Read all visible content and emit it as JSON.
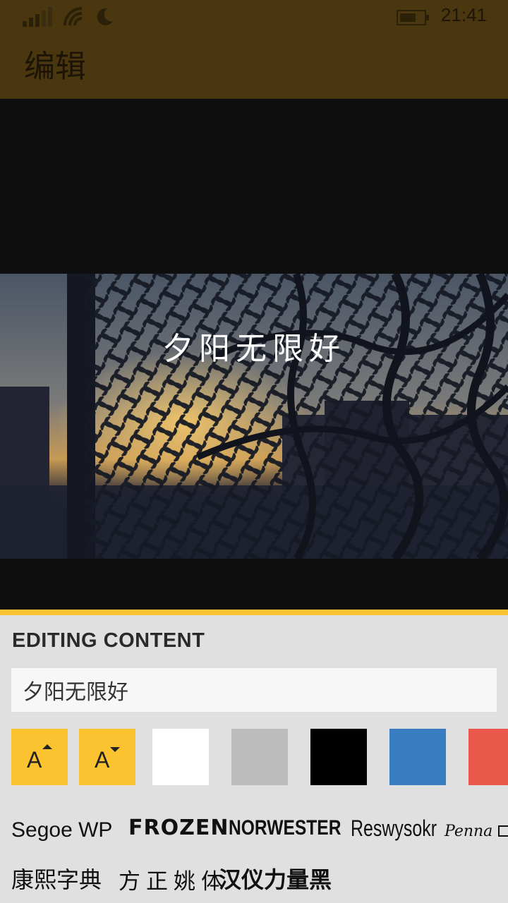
{
  "status_bar": {
    "time": "21:41"
  },
  "header": {
    "title": "编辑"
  },
  "canvas": {
    "overlay_text": "夕阳无限好"
  },
  "panel": {
    "title": "EDITING CONTENT",
    "input_value": "夕阳无限好",
    "tools": [
      {
        "name": "increase-font-size",
        "label": "A",
        "icon": "caret-up"
      },
      {
        "name": "decrease-font-size",
        "label": "A",
        "icon": "caret-down"
      }
    ],
    "colors": [
      "#ffffff",
      "#bcbcbc",
      "#000000",
      "#3a7ec2",
      "#e9584a"
    ],
    "accent": "#fcc330",
    "fonts_row1": [
      "Segoe WP",
      "FROZEN",
      "NORWESTER",
      "Reswysokr",
      "Penna"
    ],
    "fonts_row2": [
      "康熙字典",
      "方正姚体",
      "汉仪力量黑"
    ]
  }
}
